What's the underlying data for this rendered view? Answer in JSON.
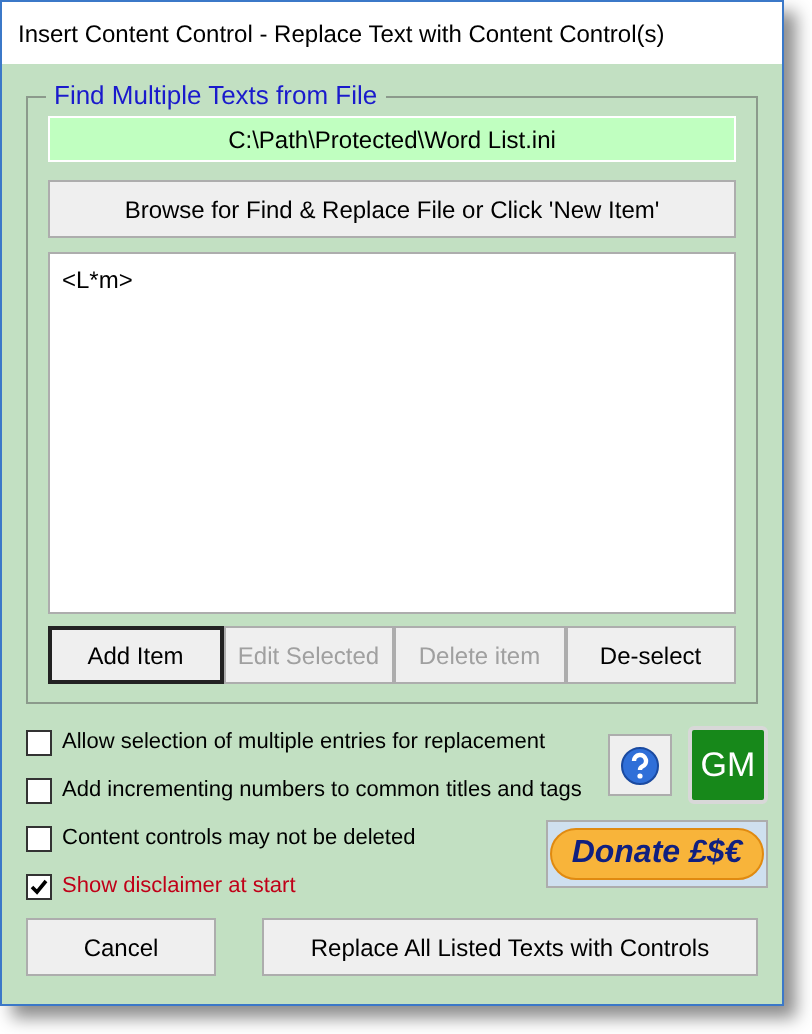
{
  "window": {
    "title": "Insert Content Control - Replace Text with Content Control(s)"
  },
  "group": {
    "title": "Find Multiple Texts from File",
    "path": "C:\\Path\\Protected\\Word List.ini",
    "browse_button": "Browse for Find & Replace File or Click 'New Item'",
    "list_items": [
      {
        "text": "<L*m>",
        "selected": false
      }
    ],
    "buttons": [
      {
        "label": "Add Item",
        "disabled": false,
        "default": true
      },
      {
        "label": "Edit Selected",
        "disabled": true,
        "default": false
      },
      {
        "label": "Delete item",
        "disabled": true,
        "default": false
      },
      {
        "label": "De-select",
        "disabled": false,
        "default": false
      }
    ]
  },
  "options": [
    {
      "label": "Allow selection of multiple entries for replacement",
      "checked": false,
      "highlight": false
    },
    {
      "label": "Add incrementing numbers to common titles and tags",
      "checked": false,
      "highlight": false
    },
    {
      "label": "Content controls may not be deleted",
      "checked": false,
      "highlight": false
    },
    {
      "label": "Show disclaimer at start",
      "checked": true,
      "highlight": true
    }
  ],
  "gm_button": "GM",
  "donate_button": "Donate £$€",
  "footer_buttons": [
    "Cancel",
    "Replace All Listed Texts with Controls"
  ]
}
